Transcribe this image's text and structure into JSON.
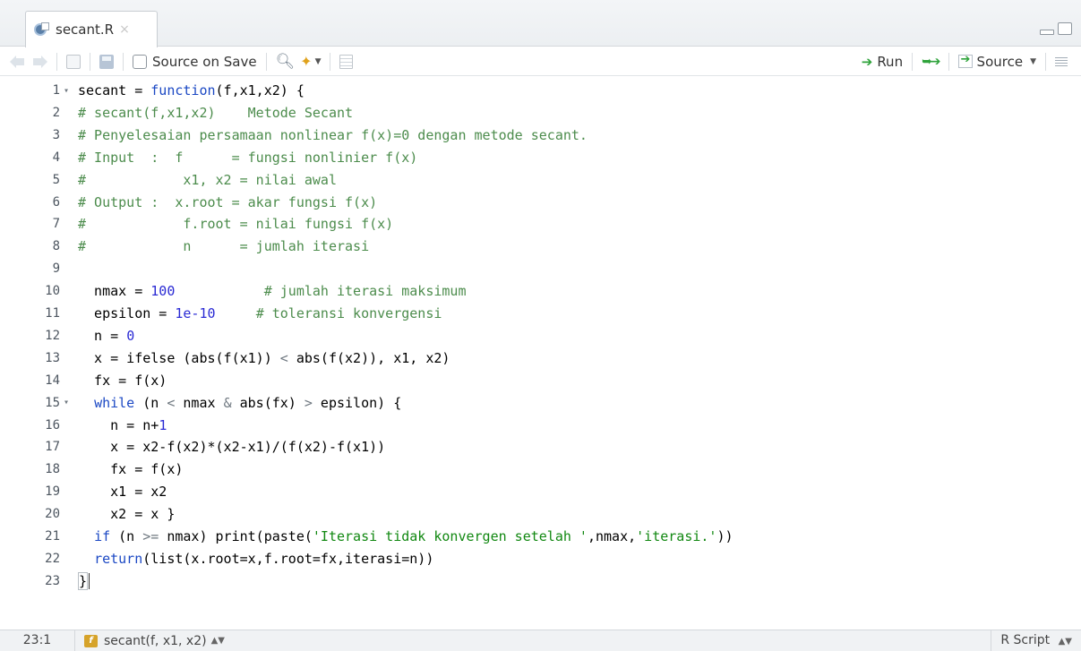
{
  "tab": {
    "filename": "secant.R",
    "close_glyph": "×"
  },
  "toolbar": {
    "source_on_save_label": "Source on Save",
    "run_label": "Run",
    "source_label": "Source"
  },
  "editor": {
    "lines": [
      {
        "n": "1",
        "fold": "▾",
        "html": "secant = <span class=\"kw\">function</span>(f,x1,x2) {"
      },
      {
        "n": "2",
        "fold": "",
        "html": "<span class=\"cmt\"># secant(f,x1,x2)    Metode Secant</span>"
      },
      {
        "n": "3",
        "fold": "",
        "html": "<span class=\"cmt\"># Penyelesaian persamaan nonlinear f(x)=0 dengan metode secant.</span>"
      },
      {
        "n": "4",
        "fold": "",
        "html": "<span class=\"cmt\"># Input  :  f      = fungsi nonlinier f(x)</span>"
      },
      {
        "n": "5",
        "fold": "",
        "html": "<span class=\"cmt\">#            x1, x2 = nilai awal</span>"
      },
      {
        "n": "6",
        "fold": "",
        "html": "<span class=\"cmt\"># Output :  x.root = akar fungsi f(x)</span>"
      },
      {
        "n": "7",
        "fold": "",
        "html": "<span class=\"cmt\">#            f.root = nilai fungsi f(x)</span>"
      },
      {
        "n": "8",
        "fold": "",
        "html": "<span class=\"cmt\">#            n      = jumlah iterasi</span>"
      },
      {
        "n": "9",
        "fold": "",
        "html": ""
      },
      {
        "n": "10",
        "fold": "",
        "html": "  nmax = <span class=\"num\">100</span>           <span class=\"cmt\"># jumlah iterasi maksimum</span>"
      },
      {
        "n": "11",
        "fold": "",
        "html": "  epsilon = <span class=\"num\">1e-10</span>     <span class=\"cmt\"># toleransi konvergensi</span>"
      },
      {
        "n": "12",
        "fold": "",
        "html": "  n = <span class=\"num\">0</span>"
      },
      {
        "n": "13",
        "fold": "",
        "html": "  x = ifelse (abs(f(x1)) <span class=\"op\">&lt;</span> abs(f(x2)), x1, x2)"
      },
      {
        "n": "14",
        "fold": "",
        "html": "  fx = f(x)"
      },
      {
        "n": "15",
        "fold": "▾",
        "html": "  <span class=\"kw\">while</span> (n <span class=\"op\">&lt;</span> nmax <span class=\"op\">&amp;</span> abs(fx) <span class=\"op\">&gt;</span> epsilon) {"
      },
      {
        "n": "16",
        "fold": "",
        "html": "    n = n+<span class=\"num\">1</span>"
      },
      {
        "n": "17",
        "fold": "",
        "html": "    x = x2-f(x2)*(x2-x1)/(f(x2)-f(x1))"
      },
      {
        "n": "18",
        "fold": "",
        "html": "    fx = f(x)"
      },
      {
        "n": "19",
        "fold": "",
        "html": "    x1 = x2"
      },
      {
        "n": "20",
        "fold": "",
        "html": "    x2 = x }"
      },
      {
        "n": "21",
        "fold": "",
        "html": "  <span class=\"kw\">if</span> (n <span class=\"op\">&gt;=</span> nmax) print(paste(<span class=\"str\">'Iterasi tidak konvergen setelah '</span>,nmax,<span class=\"str\">'iterasi.'</span>))"
      },
      {
        "n": "22",
        "fold": "",
        "html": "  <span class=\"kw\">return</span>(list(x.root=x,f.root=fx,iterasi=n))"
      },
      {
        "n": "23",
        "fold": "",
        "html": "<span class=\"bracket-hl\">}</span>"
      }
    ]
  },
  "statusbar": {
    "position": "23:1",
    "scope": "secant(f, x1, x2)",
    "file_type": "R Script"
  }
}
